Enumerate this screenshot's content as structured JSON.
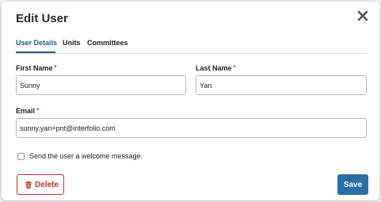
{
  "dialog": {
    "title": "Edit User"
  },
  "tabs": [
    {
      "label": "User Details",
      "active": true
    },
    {
      "label": "Units",
      "active": false
    },
    {
      "label": "Committees",
      "active": false
    }
  ],
  "form": {
    "first_name": {
      "label": "First Name",
      "required_mark": "*",
      "value": "Sunny"
    },
    "last_name": {
      "label": "Last Name",
      "required_mark": "*",
      "value": "Yan"
    },
    "email": {
      "label": "Email",
      "required_mark": "*",
      "value": "sunny.yan+pnt@interfolio.com"
    },
    "welcome": {
      "label": "Send the user a welcome message.",
      "checked": false
    }
  },
  "buttons": {
    "delete_label": "Delete",
    "save_label": "Save"
  },
  "icons": {
    "close": "close-icon",
    "trash": "trash-icon"
  },
  "colors": {
    "accent": "#2a6fa3",
    "tab_active": "#1f5b87",
    "danger": "#c9302c",
    "required": "#d23b3b"
  }
}
